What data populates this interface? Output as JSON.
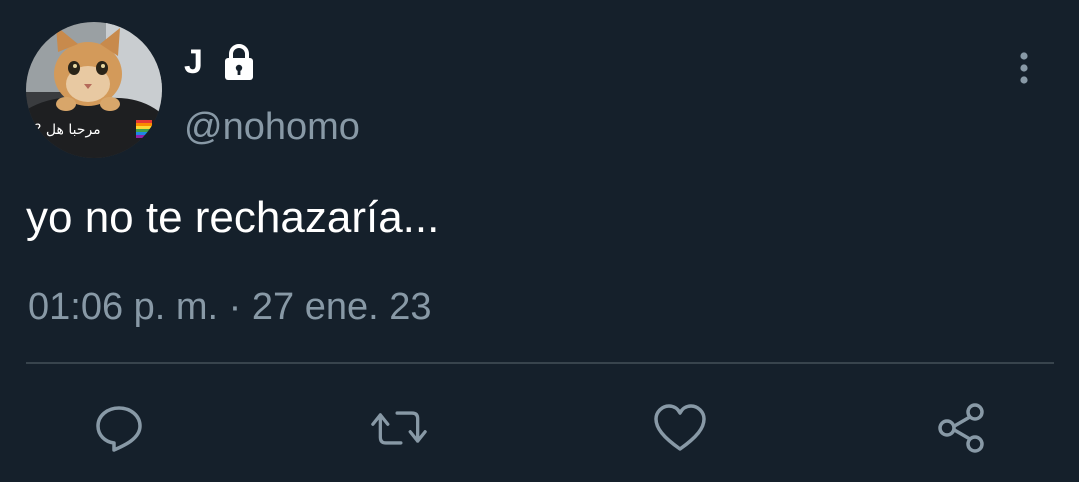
{
  "user": {
    "display_name": "J",
    "handle": "@nohomo",
    "protected": true,
    "avatar_caption": "مرحبا هل ?"
  },
  "tweet": {
    "text": "yo no te rechazaría...",
    "timestamp": "01:06 p. m. · 27 ene. 23"
  },
  "actions": [
    {
      "name": "reply",
      "icon": "reply-icon"
    },
    {
      "name": "retweet",
      "icon": "retweet-icon"
    },
    {
      "name": "like",
      "icon": "heart-icon"
    },
    {
      "name": "share",
      "icon": "share-icon"
    }
  ],
  "colors": {
    "background": "#15202b",
    "text": "#ffffff",
    "secondary_text": "#8899a6",
    "divider": "#38444d"
  }
}
